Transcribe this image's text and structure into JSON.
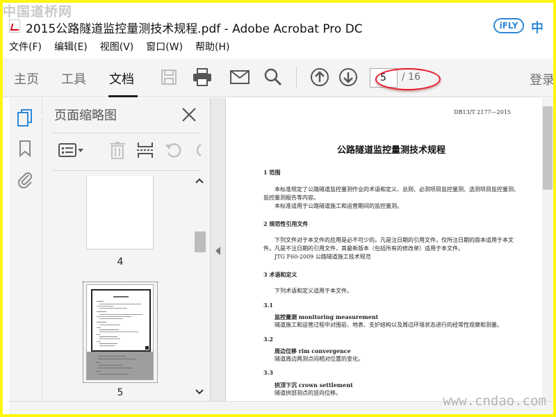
{
  "watermarks": {
    "top": "中国道桥网",
    "bottom": "www.cndao.com"
  },
  "window": {
    "title": "2015公路隧道监控量测技术规程.pdf - Adobe Acrobat Pro DC"
  },
  "badge": {
    "logo": "iFLY",
    "zh": "中"
  },
  "menu": [
    "文件(F)",
    "编辑(E)",
    "视图(V)",
    "窗口(W)",
    "帮助(H)"
  ],
  "toolbar": {
    "tabs": [
      "主页",
      "工具",
      "文档"
    ],
    "active_tab": "文档",
    "icons": [
      "save-icon",
      "print-icon",
      "email-icon",
      "search-icon",
      "page-up-icon",
      "page-down-icon"
    ],
    "page_number": "5",
    "page_total": "/ 16",
    "login": "登录"
  },
  "left_rail": {
    "icons": [
      "page-thumbnails-icon",
      "bookmark-icon",
      "attachment-icon"
    ]
  },
  "thumbnails_panel": {
    "title": "页面缩略图",
    "tools": [
      "thumbnail-options-icon",
      "delete-icon",
      "insert-page-icon",
      "undo-icon",
      "redo-icon"
    ],
    "pages": [
      {
        "label": "4",
        "selected": false
      },
      {
        "label": "5",
        "selected": true
      }
    ]
  },
  "document": {
    "header": "DB13/T 2177—2015",
    "title": "公路隧道监控量测技术规程",
    "lines": [
      "1  范围",
      "本标准规定了公路隧道监控量测作业的术语和定义、总则、必测项目监控量测、选测项目监控量测、",
      "监控量测报告等内容。",
      "本标准适用于公路隧道施工和运营期间的监控量测。",
      "2  规范性引用文件",
      "下列文件对于本文件的应用是必不可少的。凡是注日期的引用文件，仅所注日期的版本适用于本文",
      "件。凡是不注日期的引用文件，其最新版本（包括所有的修改单）适用于本文件。",
      "JTG F60-2009  公路隧道施工技术规范",
      "3  术语和定义",
      "下列术语和定义适用于本文件。",
      "3.1",
      "监控量测  monitoring measurement",
      "隧道施工和运营过程中对围岩、地表、支护结构以及周边环境状态进行的经常性观察和测量。",
      "3.2",
      "周边位移  rim convergence",
      "隧道周边两测点间相对位置的变化。",
      "3.3",
      "拱顶下沉  crown settlement",
      "隧道拱部测点的竖向位移。"
    ]
  },
  "colors": {
    "highlight_circle": "#e8182a",
    "accent_blue": "#2b88d8",
    "frame_yellow": "#fef70a"
  }
}
